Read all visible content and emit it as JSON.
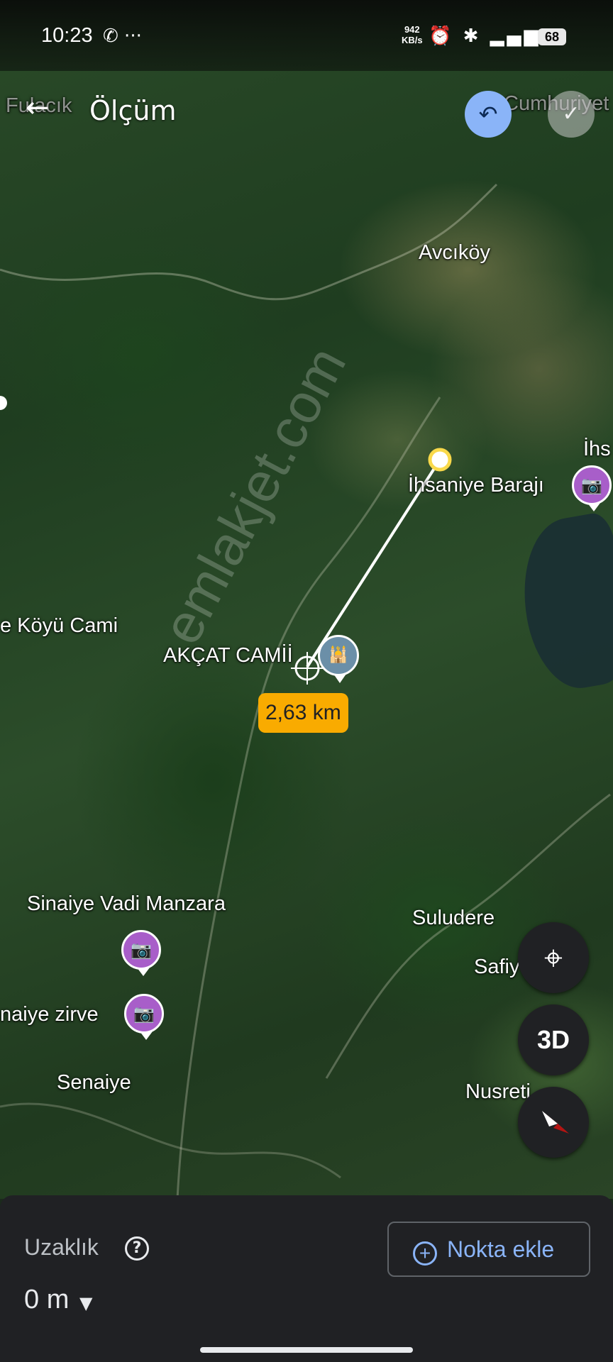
{
  "status_bar": {
    "time": "10:23",
    "left_icons": "✆ ···",
    "net_speed_value": "942",
    "net_speed_unit": "KB/s",
    "right_icons": "⏰ ✱ ▂▄▆ ◠",
    "battery": "68"
  },
  "topbar": {
    "title": "Ölçüm",
    "back_icon": "arrow-left",
    "undo_icon": "undo",
    "done_icon": "check"
  },
  "map": {
    "labels": {
      "fulacik": "Fulacık",
      "cumhuriyet": "Cumhuriyet",
      "avcikoy": "Avcıköy",
      "ihsaniye_baraji": "İhsaniye Barajı",
      "ihs_partial": "İhs",
      "koyu_cami": "e Köyü Cami",
      "akcat_camii": "AKÇAT CAMİİ",
      "sinaiye_vadi": "Sinaiye Vadi Manzara",
      "naiye_zirve": "naiye zirve",
      "senaiye": "Senaiye",
      "suludere": "Suludere",
      "safiy": "Safiy",
      "nusret": "Nusreti"
    },
    "measurement": {
      "distance": "2,63 km"
    },
    "watermark": "emlakjet.com"
  },
  "fabs": {
    "location_icon": "my-location",
    "three_d": "3D",
    "compass_icon": "compass"
  },
  "bottom_panel": {
    "label": "Uzaklık",
    "help_icon": "?",
    "add_point": "Nokta ekle",
    "value": "0 m"
  },
  "colors": {
    "accent_blue": "#8ab4f8",
    "distance_badge": "#f9ab00",
    "poi_purple": "#a85ec9",
    "panel_bg": "#202124"
  }
}
